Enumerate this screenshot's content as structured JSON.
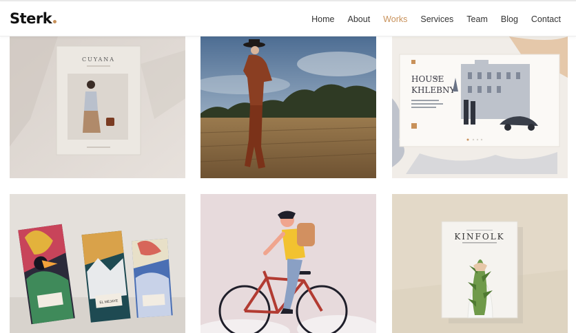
{
  "brand": {
    "name": "Sterk",
    "accent_color": "#c8915a"
  },
  "nav": {
    "items": [
      {
        "label": "Home",
        "active": false
      },
      {
        "label": "About",
        "active": false
      },
      {
        "label": "Works",
        "active": true
      },
      {
        "label": "Services",
        "active": false
      },
      {
        "label": "Team",
        "active": false
      },
      {
        "label": "Blog",
        "active": false
      },
      {
        "label": "Contact",
        "active": false
      }
    ]
  },
  "portfolio": {
    "items": [
      {
        "cover_title": "CUYANA",
        "subject": "fashion magazine cover mockup"
      },
      {
        "subject": "model in field photograph"
      },
      {
        "cover_title_line1": "HOUSE",
        "cover_title_small": "AT",
        "cover_title_line2": "KHLEBNY",
        "subject": "website illustration mockup"
      },
      {
        "package_label": "EL MEJAYE",
        "subject": "illustrated chocolate packaging"
      },
      {
        "subject": "cyclist illustration"
      },
      {
        "cover_title": "KINFOLK",
        "subject": "magazine cover mockup"
      }
    ]
  }
}
